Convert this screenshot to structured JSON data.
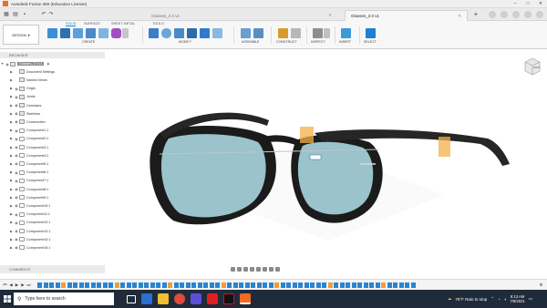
{
  "window": {
    "title": "Autodesk Fusion 360 (Education License)"
  },
  "tabs": [
    {
      "label": "Glasses_2.0 v1",
      "active": false
    },
    {
      "label": "Glasses_2.0 v1",
      "active": true
    }
  ],
  "ribbon": {
    "workspace": "DESIGN",
    "tabs": [
      "SOLID",
      "SURFACE",
      "SHEET METAL",
      "TOOLS"
    ],
    "groups": [
      "CREATE",
      "MODIFY",
      "ASSEMBLE",
      "CONSTRUCT",
      "INSPECT",
      "INSERT",
      "SELECT"
    ]
  },
  "browser": {
    "header": "BROWSER",
    "root": "Glasses_2.0 v1",
    "items": [
      "Document Settings",
      "Named Views",
      "Origin",
      "Joints",
      "Canvases",
      "Sketches",
      "Construction",
      "Component1:1",
      "Component2:1",
      "Component3:1",
      "Component4:1",
      "Component5:1",
      "Component6:1",
      "Component7:1",
      "Component8:1",
      "Component9:1",
      "Component10:1",
      "Component11:1",
      "Component12:1",
      "Component13:1",
      "Component14:1",
      "Component15:1"
    ]
  },
  "comments": {
    "label": "COMMENTS"
  },
  "viewcube": {
    "label": "RIGHT"
  },
  "taskbar": {
    "search_placeholder": "Type here to search",
    "weather": "75°F  Rain to stop",
    "time": "8:13 AM",
    "date": "7/8/2021"
  },
  "colors": {
    "accent": "#0696d7",
    "taskbar": "#202b3a",
    "frame": "#1e1e1e",
    "lens": "#a9d6df"
  }
}
